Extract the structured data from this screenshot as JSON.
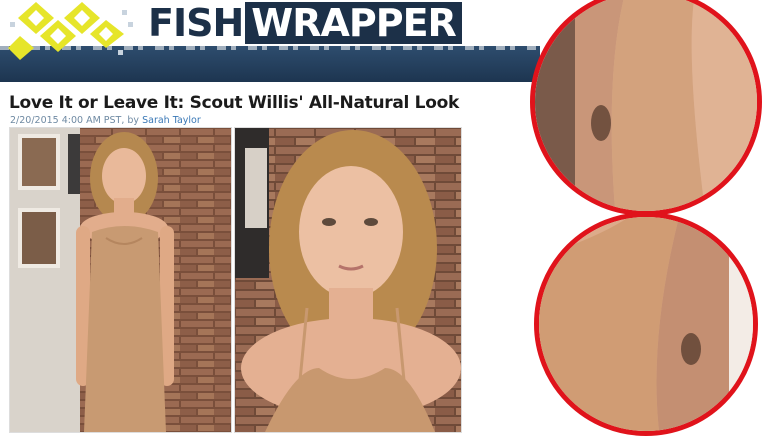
{
  "site": {
    "brand_part1": "FISH",
    "brand_part2": "WRAPPER",
    "logo_icon": "pixel-diamond-logo-icon",
    "colors": {
      "navy": "#1c3048",
      "logo_yellow": "#e6e52a",
      "zoom_ring": "#e0131b",
      "link": "#3a78b6"
    }
  },
  "article": {
    "title": "Love It or Leave It: Scout Willis' All-Natural Look",
    "date": "2/20/2015 4:00 AM PST, by",
    "author": "Sarah Taylor"
  }
}
